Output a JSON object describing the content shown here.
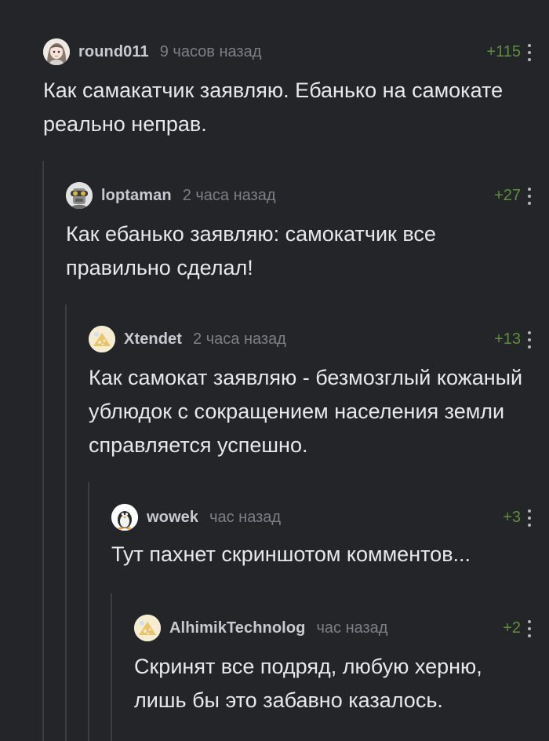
{
  "comments": [
    {
      "username": "round011",
      "time": "9 часов назад",
      "rating": "+115",
      "text": "Как самакатчик заявляю. Ебанько на самокате реально неправ.",
      "avatar_icon": "anime-girl-avatar"
    },
    {
      "username": "loptaman",
      "time": "2 часа назад",
      "rating": "+27",
      "text": "Как ебанько заявляю: самокатчик все правильно сделал!",
      "avatar_icon": "robot-goggles-avatar"
    },
    {
      "username": "Xtendet",
      "time": "2 часа назад",
      "rating": "+13",
      "text": "Как самокат заявляю - безмозглый кожаный ублюдок с сокращением населения земли справляется успешно.",
      "avatar_icon": "default-avatar"
    },
    {
      "username": "wowek",
      "time": "час назад",
      "rating": "+3",
      "text": "Тут пахнет скриншотом комментов...",
      "avatar_icon": "penguin-avatar"
    },
    {
      "username": "AlhimikTechnolog",
      "time": "час назад",
      "rating": "+2",
      "text": "Скринят все подряд, любую херню, лишь бы это забавно казалось.",
      "avatar_icon": "default-avatar"
    }
  ],
  "colors": {
    "background": "#232528",
    "rating": "#5f8e3e",
    "username": "#c7cbd1",
    "time": "#7b8087",
    "text": "#e6e8eb",
    "branch_line": "#3a3d42"
  }
}
